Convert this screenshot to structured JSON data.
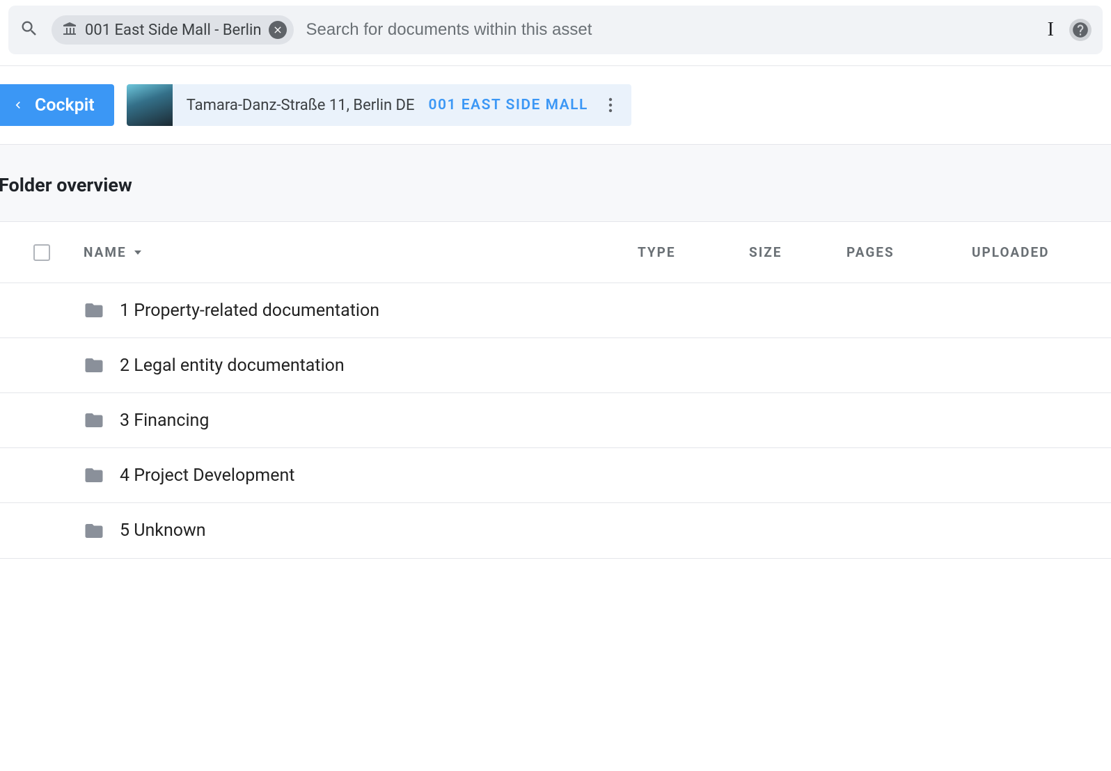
{
  "search": {
    "chip_label": "001 East Side Mall - Berlin",
    "placeholder": "Search for documents within this asset"
  },
  "header": {
    "cockpit_label": "Cockpit",
    "asset_address": "Tamara-Danz-Straße 11,  Berlin DE",
    "asset_name": "001 EAST SIDE MALL"
  },
  "section_title": "Folder overview",
  "columns": {
    "name": "NAME",
    "type": "TYPE",
    "size": "SIZE",
    "pages": "PAGES",
    "uploaded": "UPLOADED"
  },
  "rows": [
    {
      "name": "1 Property-related documentation"
    },
    {
      "name": "2 Legal entity documentation"
    },
    {
      "name": "3 Financing"
    },
    {
      "name": "4 Project Development"
    },
    {
      "name": "5 Unknown"
    }
  ]
}
